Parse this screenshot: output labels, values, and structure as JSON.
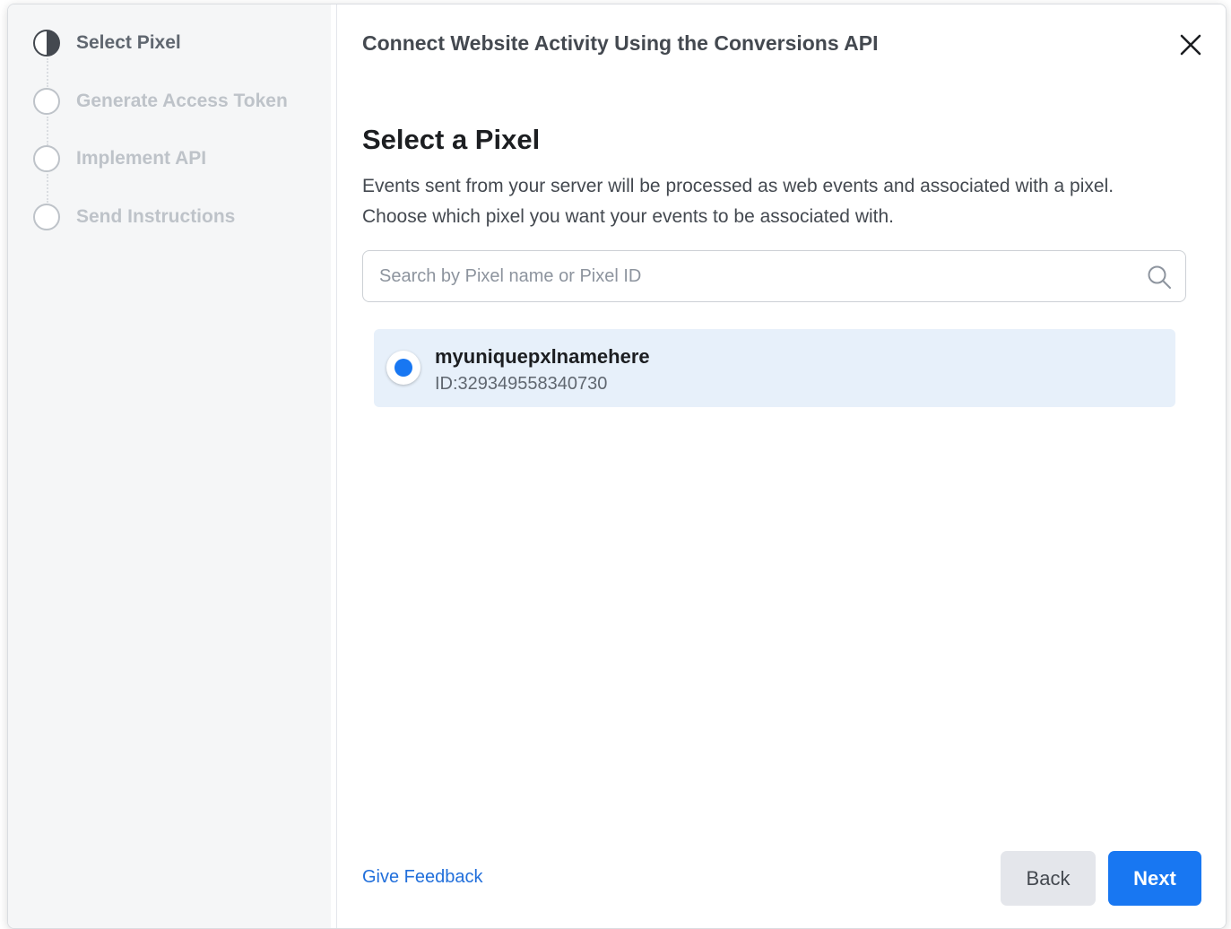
{
  "sidebar": {
    "steps": [
      {
        "label": "Select Pixel",
        "state": "active"
      },
      {
        "label": "Generate Access Token",
        "state": "pending"
      },
      {
        "label": "Implement API",
        "state": "pending"
      },
      {
        "label": "Send Instructions",
        "state": "pending"
      }
    ]
  },
  "header": {
    "title": "Connect Website Activity Using the Conversions API",
    "close_icon": "close-icon"
  },
  "main": {
    "section_title": "Select a Pixel",
    "description": "Events sent from your server will be processed as web events and associated with a pixel. Choose which pixel you want your events to be associated with.",
    "search": {
      "placeholder": "Search by Pixel name or Pixel ID",
      "value": "",
      "icon": "search-icon"
    },
    "pixels": [
      {
        "name": "myuniquepxlnamehere",
        "id_text": "ID:329349558340730",
        "selected": true
      }
    ]
  },
  "footer": {
    "feedback_label": "Give Feedback",
    "back_label": "Back",
    "next_label": "Next"
  },
  "colors": {
    "accent": "#1877f2",
    "selected_row": "#e7f0fa",
    "link": "#216fdb"
  }
}
